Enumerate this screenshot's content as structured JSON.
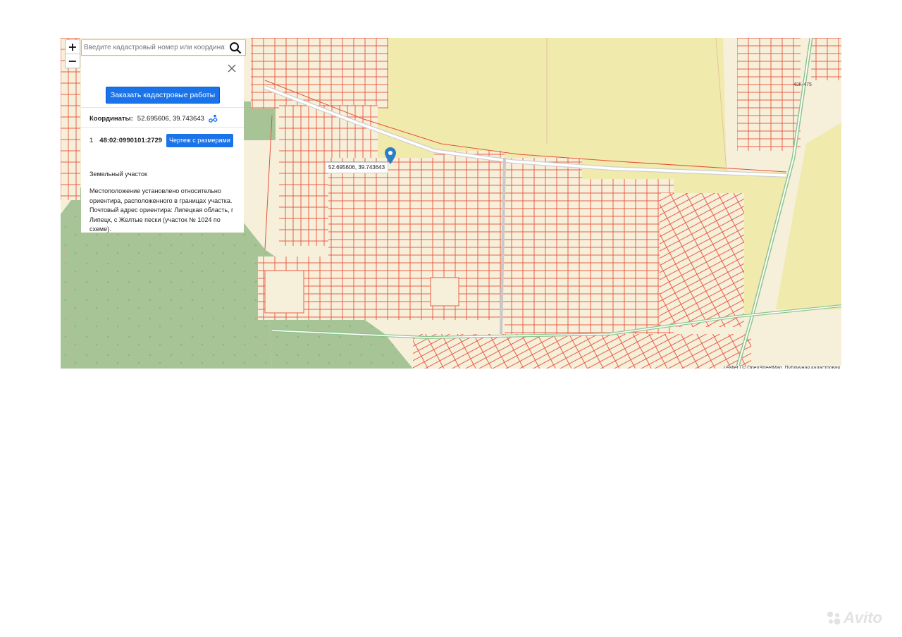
{
  "map": {
    "zoom_in": "+",
    "zoom_out": "−",
    "search_placeholder": "Введите кадастровый номер или координаты",
    "marker_label": "52.695606, 39.743643",
    "road_number": "42К-475",
    "attribution": "Leaflet | © OpenStreetMap, Публичная кадастровая"
  },
  "panel": {
    "order_button": "Заказать кадастровые работы",
    "coords_label": "Координаты:",
    "coords_value": "52.695606, 39.743643",
    "item_index": "1",
    "cadastral_number": "48:02:0990101:2729",
    "drawing_button": "Чертеж с размерами",
    "parcel_type": "Земельный участок",
    "description": "Местоположение установлено относительно ориентира, расположенного в границах участка. Почтовый адрес ориентира: Липецкая область, г Липецк, с Желтые пески (участок № 1024 по схеме)."
  },
  "watermark": "Avito",
  "colors": {
    "parcel_line": "#e8503a",
    "forest": "#a7c497",
    "field": "#f0eaad",
    "settlement": "#f6efda",
    "button": "#1a73e8",
    "marker": "#2a7fc6"
  },
  "icons": {
    "search": "search-icon",
    "close": "close-icon",
    "coords": "location-share-icon",
    "marker": "map-pin-icon",
    "watermark": "avito-logo-icon"
  }
}
